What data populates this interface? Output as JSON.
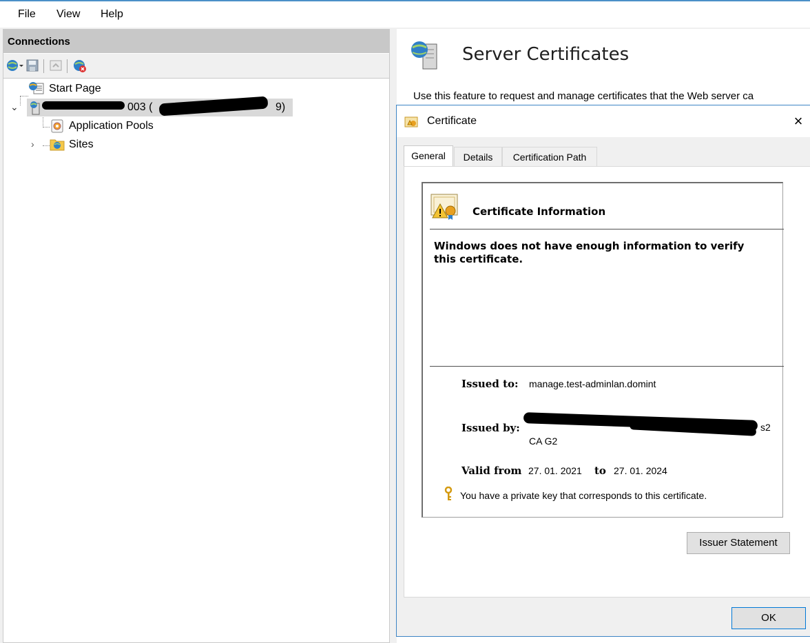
{
  "menu": {
    "file": "File",
    "view": "View",
    "help": "Help"
  },
  "connections": {
    "header": "Connections",
    "tree": {
      "start_page": "Start Page",
      "server_visible_fragment": "003 (",
      "server_visible_tail": "9)",
      "app_pools": "Application Pools",
      "sites": "Sites"
    }
  },
  "feature": {
    "title": "Server Certificates",
    "description": "Use this feature to request and manage certificates that the Web server ca"
  },
  "dialog": {
    "title": "Certificate",
    "close_glyph": "×",
    "tabs": [
      "General",
      "Details",
      "Certification Path"
    ],
    "info_heading": "Certificate Information",
    "warning": "Windows does not have enough information to verify this certificate.",
    "issued_to_label": "Issued to:",
    "issued_to_value": "manage.test-adminlan.domint",
    "issued_by_label": "Issued by:",
    "issued_by_tail": "s2",
    "issued_by_line2": "CA G2",
    "valid_from_label": "Valid from",
    "valid_from": "27. 01. 2021",
    "to_label": "to",
    "valid_to": "27. 01. 2024",
    "private_key_note": "You have a private key that corresponds to this certificate.",
    "issuer_statement_button": "Issuer Statement",
    "ok_button": "OK"
  },
  "colors": {
    "accent": "#0078d7",
    "header_gray": "#c8c8c8",
    "cert_gold": "#e8b84a"
  }
}
